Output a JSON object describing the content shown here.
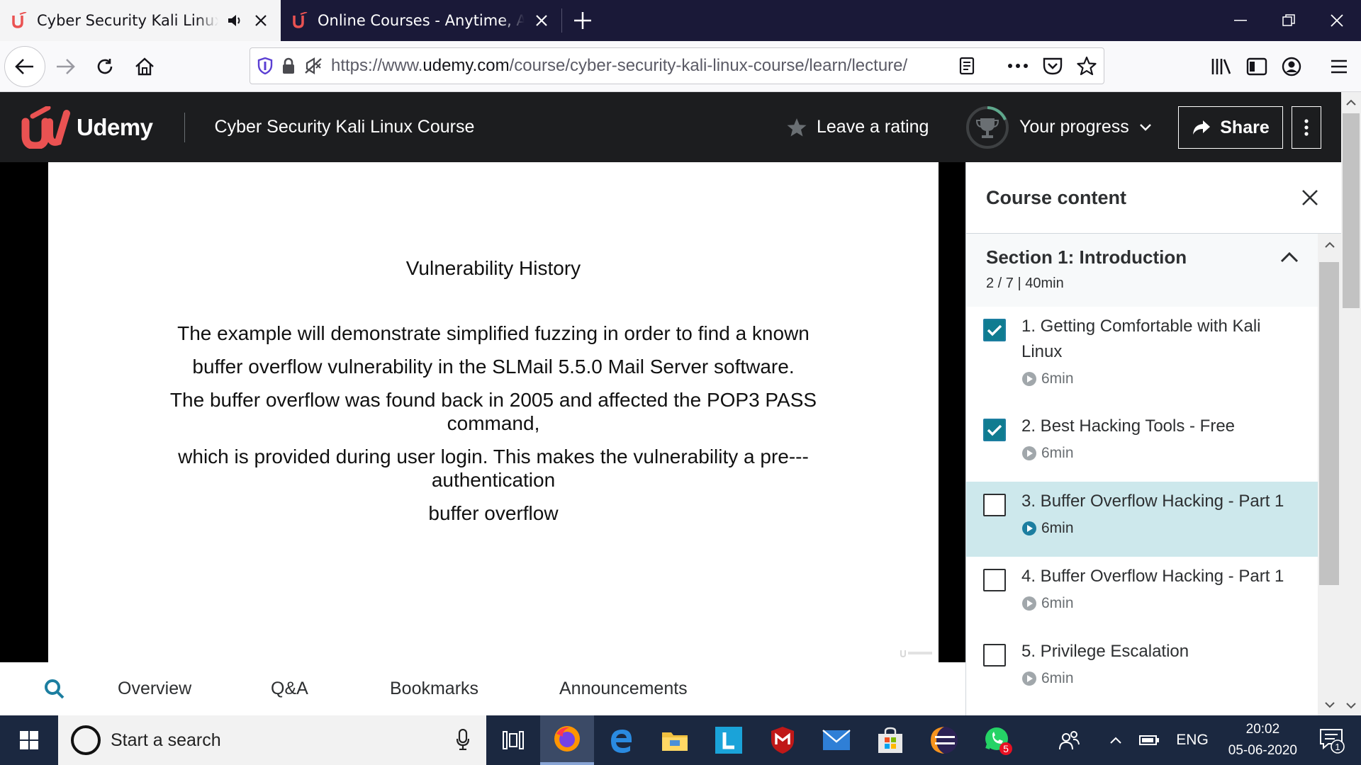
{
  "browser": {
    "tabs": [
      {
        "title": "Cyber Security Kali Linux Course",
        "active": true
      },
      {
        "title": "Online Courses - Anytime, Anywhere",
        "active": false
      }
    ],
    "url": {
      "prefix": "https://www.",
      "domain": "udemy.com",
      "path": "/course/cyber-security-kali-linux-course/learn/lecture/"
    }
  },
  "header": {
    "logo_text": "Udemy",
    "course_title": "Cyber Security Kali Linux Course",
    "rating_label": "Leave a rating",
    "progress_label": "Your progress",
    "share_label": "Share"
  },
  "slide": {
    "title": "Vulnerability History",
    "lines": [
      "The example will demonstrate simplified fuzzing in order to find a known",
      "buffer overflow vulnerability in the SLMail 5.5.0 Mail Server software.",
      "The buffer overflow was found back in 2005 and affected the POP3 PASS command,",
      "which is provided during user login. This makes the vulnerability a pre---authentication",
      "buffer overflow"
    ]
  },
  "bottom_tabs": [
    "Overview",
    "Q&A",
    "Bookmarks",
    "Announcements"
  ],
  "sidebar": {
    "title": "Course content",
    "section": {
      "title": "Section 1: Introduction",
      "subtitle": "2 / 7 | 40min"
    },
    "lectures": [
      {
        "title": "1. Getting Comfortable with Kali Linux",
        "duration": "6min",
        "completed": true,
        "current": false
      },
      {
        "title": "2. Best Hacking Tools - Free",
        "duration": "6min",
        "completed": true,
        "current": false
      },
      {
        "title": "3. Buffer Overflow Hacking - Part 1",
        "duration": "6min",
        "completed": false,
        "current": true
      },
      {
        "title": "4. Buffer Overflow Hacking - Part 1",
        "duration": "6min",
        "completed": false,
        "current": false
      },
      {
        "title": "5. Privilege  Escalation",
        "duration": "6min",
        "completed": false,
        "current": false
      }
    ]
  },
  "taskbar": {
    "search_placeholder": "Start a search",
    "whatsapp_badge": "5",
    "language": "ENG",
    "time": "20:02",
    "date": "05-06-2020",
    "notification_count": "1"
  },
  "colors": {
    "udemy_red": "#ea5252",
    "header_bg": "#1c1d1f",
    "current_lecture_bg": "#cde8ec",
    "checkbox_checked": "#0f7c90",
    "taskbar_bg": "#1b2840"
  }
}
